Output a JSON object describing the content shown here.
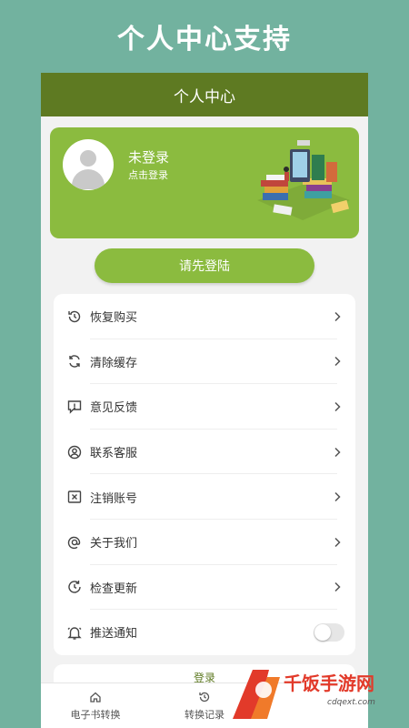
{
  "banner": {
    "title": "个人中心支持"
  },
  "appbar": {
    "title": "个人中心"
  },
  "profile": {
    "name": "未登录",
    "subtitle": "点击登录",
    "avatar_icon": "user-avatar-icon"
  },
  "login_button": {
    "label": "请先登陆"
  },
  "menu": {
    "items": [
      {
        "label": "恢复购买",
        "icon": "history-icon"
      },
      {
        "label": "清除缓存",
        "icon": "refresh-icon"
      },
      {
        "label": "意见反馈",
        "icon": "feedback-icon"
      },
      {
        "label": "联系客服",
        "icon": "user-circle-icon"
      },
      {
        "label": "注销账号",
        "icon": "close-box-icon"
      },
      {
        "label": "关于我们",
        "icon": "at-icon"
      },
      {
        "label": "检查更新",
        "icon": "update-clock-icon"
      },
      {
        "label": "推送通知",
        "icon": "bell-icon",
        "toggle": false
      }
    ]
  },
  "logout": {
    "label": "登录"
  },
  "bottom_nav": {
    "tabs": [
      {
        "label": "电子书转换",
        "icon": "home-icon"
      },
      {
        "label": "转换记录",
        "icon": "history-icon"
      }
    ]
  },
  "watermark": {
    "text": "千饭手游网",
    "sub": "cdqext.com"
  },
  "colors": {
    "background": "#72b29f",
    "appbar": "#5e7a22",
    "accent": "#8bbb3f"
  }
}
